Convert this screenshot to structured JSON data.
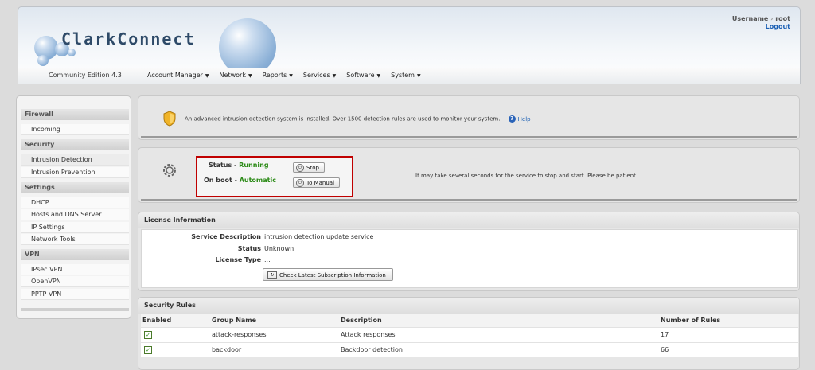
{
  "header": {
    "brand": "ClarkConnect",
    "edition": "Community Edition 4.3",
    "username_label": "Username",
    "username": "root",
    "logout": "Logout",
    "nav": [
      "Account Manager",
      "Network",
      "Reports",
      "Services",
      "Software",
      "System"
    ]
  },
  "sidebar": {
    "sections": [
      {
        "title": "Firewall",
        "items": [
          "Incoming"
        ]
      },
      {
        "title": "Security",
        "items": [
          "Intrusion Detection",
          "Intrusion Prevention"
        ]
      },
      {
        "title": "Settings",
        "items": [
          "DHCP",
          "Hosts and DNS Server",
          "IP Settings",
          "Network Tools"
        ]
      },
      {
        "title": "VPN",
        "items": [
          "IPsec VPN",
          "OpenVPN",
          "PPTP VPN"
        ]
      }
    ]
  },
  "info": {
    "message": "An advanced intrusion detection system is installed. Over 1500 detection rules are used to monitor your system.",
    "help": "Help"
  },
  "service": {
    "status_label": "Status - ",
    "status_value": "Running",
    "onboot_label": "On boot - ",
    "onboot_value": "Automatic",
    "stop_button": "Stop",
    "manual_button": "To Manual",
    "wait_message": "It may take several seconds for the service to stop and start.  Please be patient..."
  },
  "license": {
    "title": "License Information",
    "rows": [
      {
        "key": "Service Description",
        "value": "intrusion detection update service"
      },
      {
        "key": "Status",
        "value": "Unknown"
      },
      {
        "key": "License Type",
        "value": "..."
      }
    ],
    "check_button": "Check Latest Subscription Information"
  },
  "rules": {
    "title": "Security Rules",
    "columns": [
      "Enabled",
      "Group Name",
      "Description",
      "Number of Rules"
    ],
    "rows": [
      {
        "enabled": true,
        "group": "attack-responses",
        "description": "Attack responses",
        "count": "17"
      },
      {
        "enabled": true,
        "group": "backdoor",
        "description": "Backdoor detection",
        "count": "66"
      }
    ]
  },
  "colors": {
    "status_green": "#2b8a16",
    "highlight_red": "#c00000",
    "link_blue": "#1a5fb4"
  }
}
